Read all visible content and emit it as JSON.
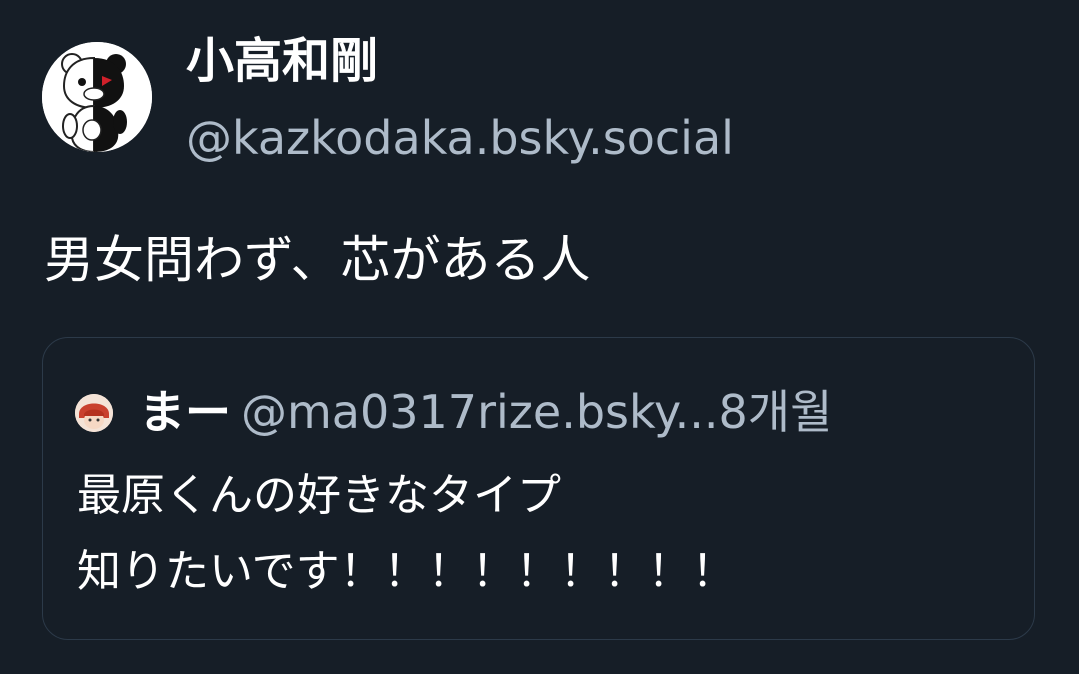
{
  "post": {
    "author": {
      "display_name": "小高和剛",
      "handle": "@kazkodaka.bsky.social",
      "avatar_icon": "monokuma-avatar-icon"
    },
    "text": "男女問わず、芯がある人"
  },
  "quote": {
    "author": {
      "display_name": "まー",
      "handle": "@ma0317rize.bsky...",
      "avatar_icon": "red-haired-character-avatar-icon"
    },
    "time": "8개월",
    "text_lines": [
      "最原くんの好きなタイプ",
      "知りたいです！！！！！！！！！"
    ]
  },
  "colors": {
    "background": "#161e27",
    "primary_text": "#ffffff",
    "secondary_text": "#aebbc9",
    "card_border": "#2c3a49"
  }
}
